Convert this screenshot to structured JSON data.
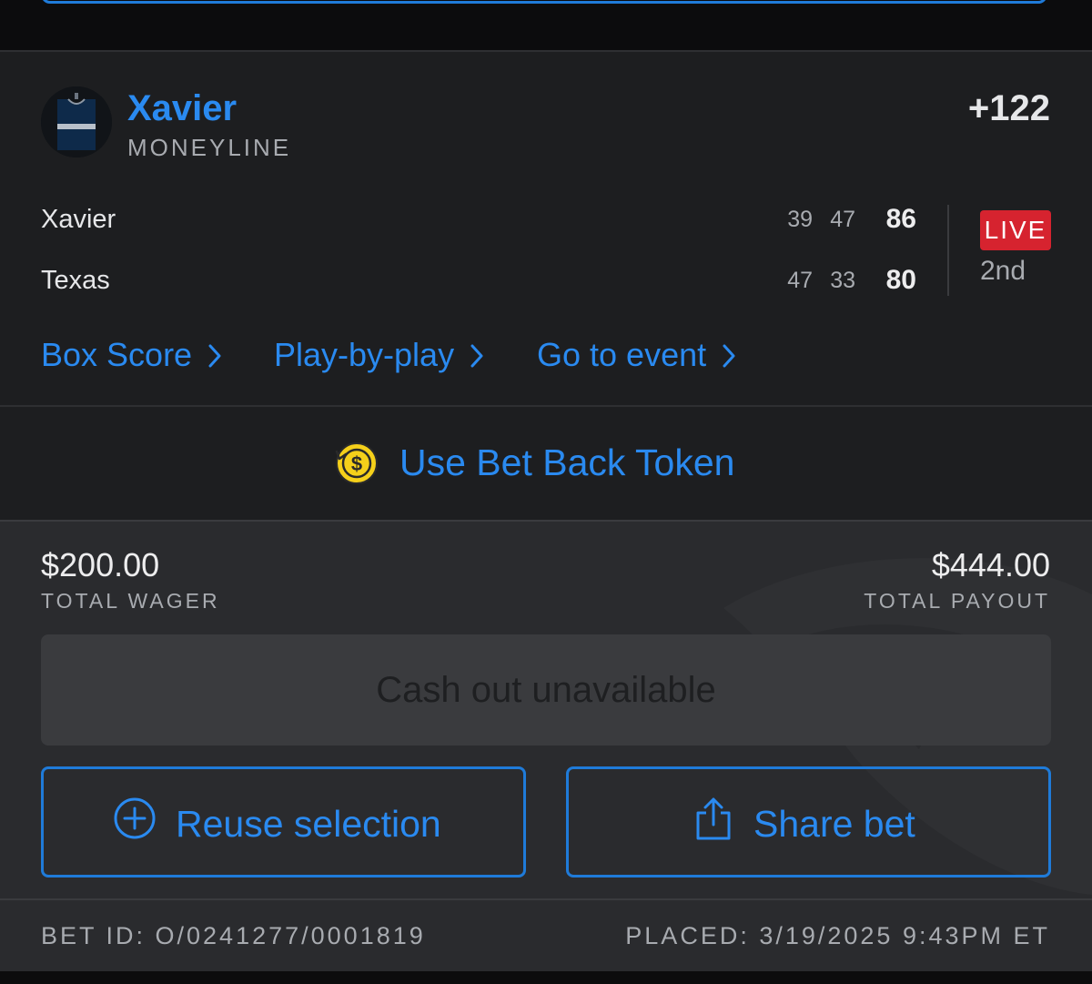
{
  "selection": {
    "team": "Xavier",
    "bet_type": "MONEYLINE",
    "odds": "+122",
    "jersey_icon": "jersey-icon",
    "scoreboard": [
      {
        "team": "Xavier",
        "q1": "39",
        "q2": "47",
        "total": "86"
      },
      {
        "team": "Texas",
        "q1": "47",
        "q2": "33",
        "total": "80"
      }
    ],
    "status": "LIVE",
    "period": "2nd",
    "links": [
      "Box Score",
      "Play-by-play",
      "Go to event"
    ]
  },
  "token": {
    "label": "Use Bet Back Token",
    "icon": "bet-back-token-icon"
  },
  "wager": {
    "total_wager": "$200.00",
    "total_wager_label": "TOTAL WAGER",
    "total_payout": "$444.00",
    "total_payout_label": "TOTAL PAYOUT",
    "cashout_label": "Cash out unavailable",
    "reuse_label": "Reuse selection",
    "share_label": "Share bet"
  },
  "footer": {
    "bet_id": "BET ID: O/0241277/0001819",
    "placed": "PLACED: 3/19/2025 9:43PM ET"
  },
  "colors": {
    "accent": "#2a8af0",
    "live": "#d6232f",
    "token": "#f5d01a"
  }
}
